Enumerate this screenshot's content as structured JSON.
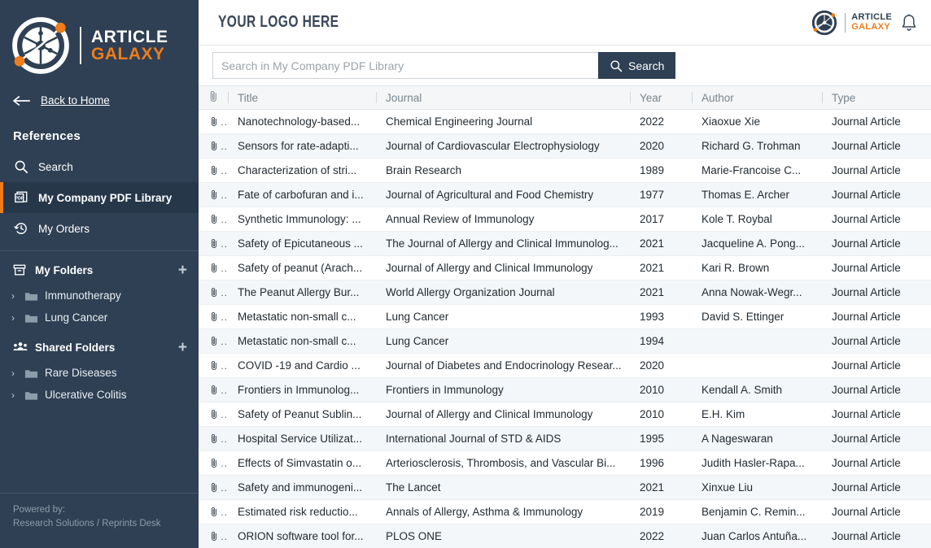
{
  "sidebar": {
    "brand": {
      "line1": "ARTICLE",
      "line2": "GALAXY",
      "logo_icon": "article-galaxy-logo-icon"
    },
    "back_link": {
      "label": "Back to Home",
      "icon": "arrow-left-icon"
    },
    "section_title": "References",
    "nav_items": [
      {
        "label": "Search",
        "icon": "search-icon",
        "active": false
      },
      {
        "label": "My Company PDF Library",
        "icon": "pdf-icon",
        "active": true
      },
      {
        "label": "My Orders",
        "icon": "history-clock-icon",
        "active": false
      }
    ],
    "my_folders": {
      "label": "My Folders",
      "icon": "archive-box-icon",
      "add_icon": "plus-icon",
      "items": [
        {
          "label": "Immunotherapy",
          "icon": "folder-icon",
          "chevron": "chevron-right-icon"
        },
        {
          "label": "Lung Cancer",
          "icon": "folder-icon",
          "chevron": "chevron-right-icon"
        }
      ]
    },
    "shared_folders": {
      "label": "Shared Folders",
      "icon": "users-group-icon",
      "add_icon": "plus-icon",
      "items": [
        {
          "label": "Rare Diseases",
          "icon": "folder-icon",
          "chevron": "chevron-right-icon"
        },
        {
          "label": "Ulcerative Colitis",
          "icon": "folder-icon",
          "chevron": "chevron-right-icon"
        }
      ]
    },
    "powered": {
      "line1": "Powered by:",
      "line2": "Research Solutions / Reprints Desk"
    },
    "colors": {
      "background": "#2f4054",
      "active_background": "#26374a",
      "accent": "#f07d1a"
    }
  },
  "header": {
    "logo_text": "YOUR LOGO HERE",
    "brand": {
      "line1": "ARTICLE",
      "line2": "GALAXY",
      "logo_icon": "article-galaxy-logo-icon"
    },
    "notification_icon": "bell-icon"
  },
  "search": {
    "placeholder": "Search in My Company PDF Library",
    "value": "",
    "button_label": "Search",
    "button_icon": "search-icon"
  },
  "table": {
    "columns": [
      {
        "key": "clip",
        "label": "",
        "icon": "paperclip-icon"
      },
      {
        "key": "title",
        "label": "Title"
      },
      {
        "key": "journal",
        "label": "Journal"
      },
      {
        "key": "year",
        "label": "Year"
      },
      {
        "key": "author",
        "label": "Author"
      },
      {
        "key": "type",
        "label": "Type"
      }
    ],
    "row_icon": "paperclip-icon",
    "row_dots": "..",
    "rows": [
      {
        "title": "Nanotechnology-based...",
        "journal": "Chemical Engineering Journal",
        "year": "2022",
        "author": "Xiaoxue Xie",
        "type": "Journal Article"
      },
      {
        "title": "Sensors for rate-adapti...",
        "journal": "Journal of Cardiovascular Electrophysiology",
        "year": "2020",
        "author": "Richard G. Trohman",
        "type": "Journal Article"
      },
      {
        "title": "Characterization of stri...",
        "journal": "Brain Research",
        "year": "1989",
        "author": "Marie-Francoise C...",
        "type": "Journal Article"
      },
      {
        "title": "Fate of carbofuran and i...",
        "journal": "Journal of Agricultural and Food Chemistry",
        "year": "1977",
        "author": "Thomas E. Archer",
        "type": "Journal Article"
      },
      {
        "title": "Synthetic Immunology: ...",
        "journal": "Annual Review of Immunology",
        "year": "2017",
        "author": "Kole T. Roybal",
        "type": "Journal Article"
      },
      {
        "title": "Safety of Epicutaneous ...",
        "journal": "The Journal of Allergy and Clinical Immunolog...",
        "year": "2021",
        "author": "Jacqueline A. Pong...",
        "type": "Journal Article"
      },
      {
        "title": "Safety of peanut (Arach...",
        "journal": "Journal of Allergy and Clinical Immunology",
        "year": "2021",
        "author": "Kari R. Brown",
        "type": "Journal Article"
      },
      {
        "title": "The Peanut Allergy Bur...",
        "journal": "World Allergy Organization Journal",
        "year": "2021",
        "author": "Anna Nowak-Wegr...",
        "type": "Journal Article"
      },
      {
        "title": "Metastatic non-small c...",
        "journal": "Lung Cancer",
        "year": "1993",
        "author": "David S. Ettinger",
        "type": "Journal Article"
      },
      {
        "title": "Metastatic non-small c...",
        "journal": "Lung Cancer",
        "year": "1994",
        "author": "",
        "type": "Journal Article"
      },
      {
        "title": "COVID -19 and Cardio ...",
        "journal": "Journal of Diabetes and Endocrinology Resear...",
        "year": "2020",
        "author": "",
        "type": "Journal Article"
      },
      {
        "title": "Frontiers in Immunolog...",
        "journal": "Frontiers in Immunology",
        "year": "2010",
        "author": "Kendall A. Smith",
        "type": "Journal Article"
      },
      {
        "title": "Safety of Peanut Sublin...",
        "journal": "Journal of Allergy and Clinical Immunology",
        "year": "2010",
        "author": "E.H. Kim",
        "type": "Journal Article"
      },
      {
        "title": "Hospital Service Utilizat...",
        "journal": "International Journal of STD & AIDS",
        "year": "1995",
        "author": "A Nageswaran",
        "type": "Journal Article"
      },
      {
        "title": "Effects of Simvastatin o...",
        "journal": "Arteriosclerosis, Thrombosis, and Vascular Bi...",
        "year": "1996",
        "author": "Judith Hasler-Rapa...",
        "type": "Journal Article"
      },
      {
        "title": "Safety and immunogeni...",
        "journal": "The Lancet",
        "year": "2021",
        "author": "Xinxue Liu",
        "type": "Journal Article"
      },
      {
        "title": "Estimated risk reductio...",
        "journal": "Annals of Allergy, Asthma & Immunology",
        "year": "2019",
        "author": "Benjamin C. Remin...",
        "type": "Journal Article"
      },
      {
        "title": "ORION software tool for...",
        "journal": "PLOS ONE",
        "year": "2022",
        "author": "Juan Carlos Antuña...",
        "type": "Journal Article"
      }
    ]
  }
}
